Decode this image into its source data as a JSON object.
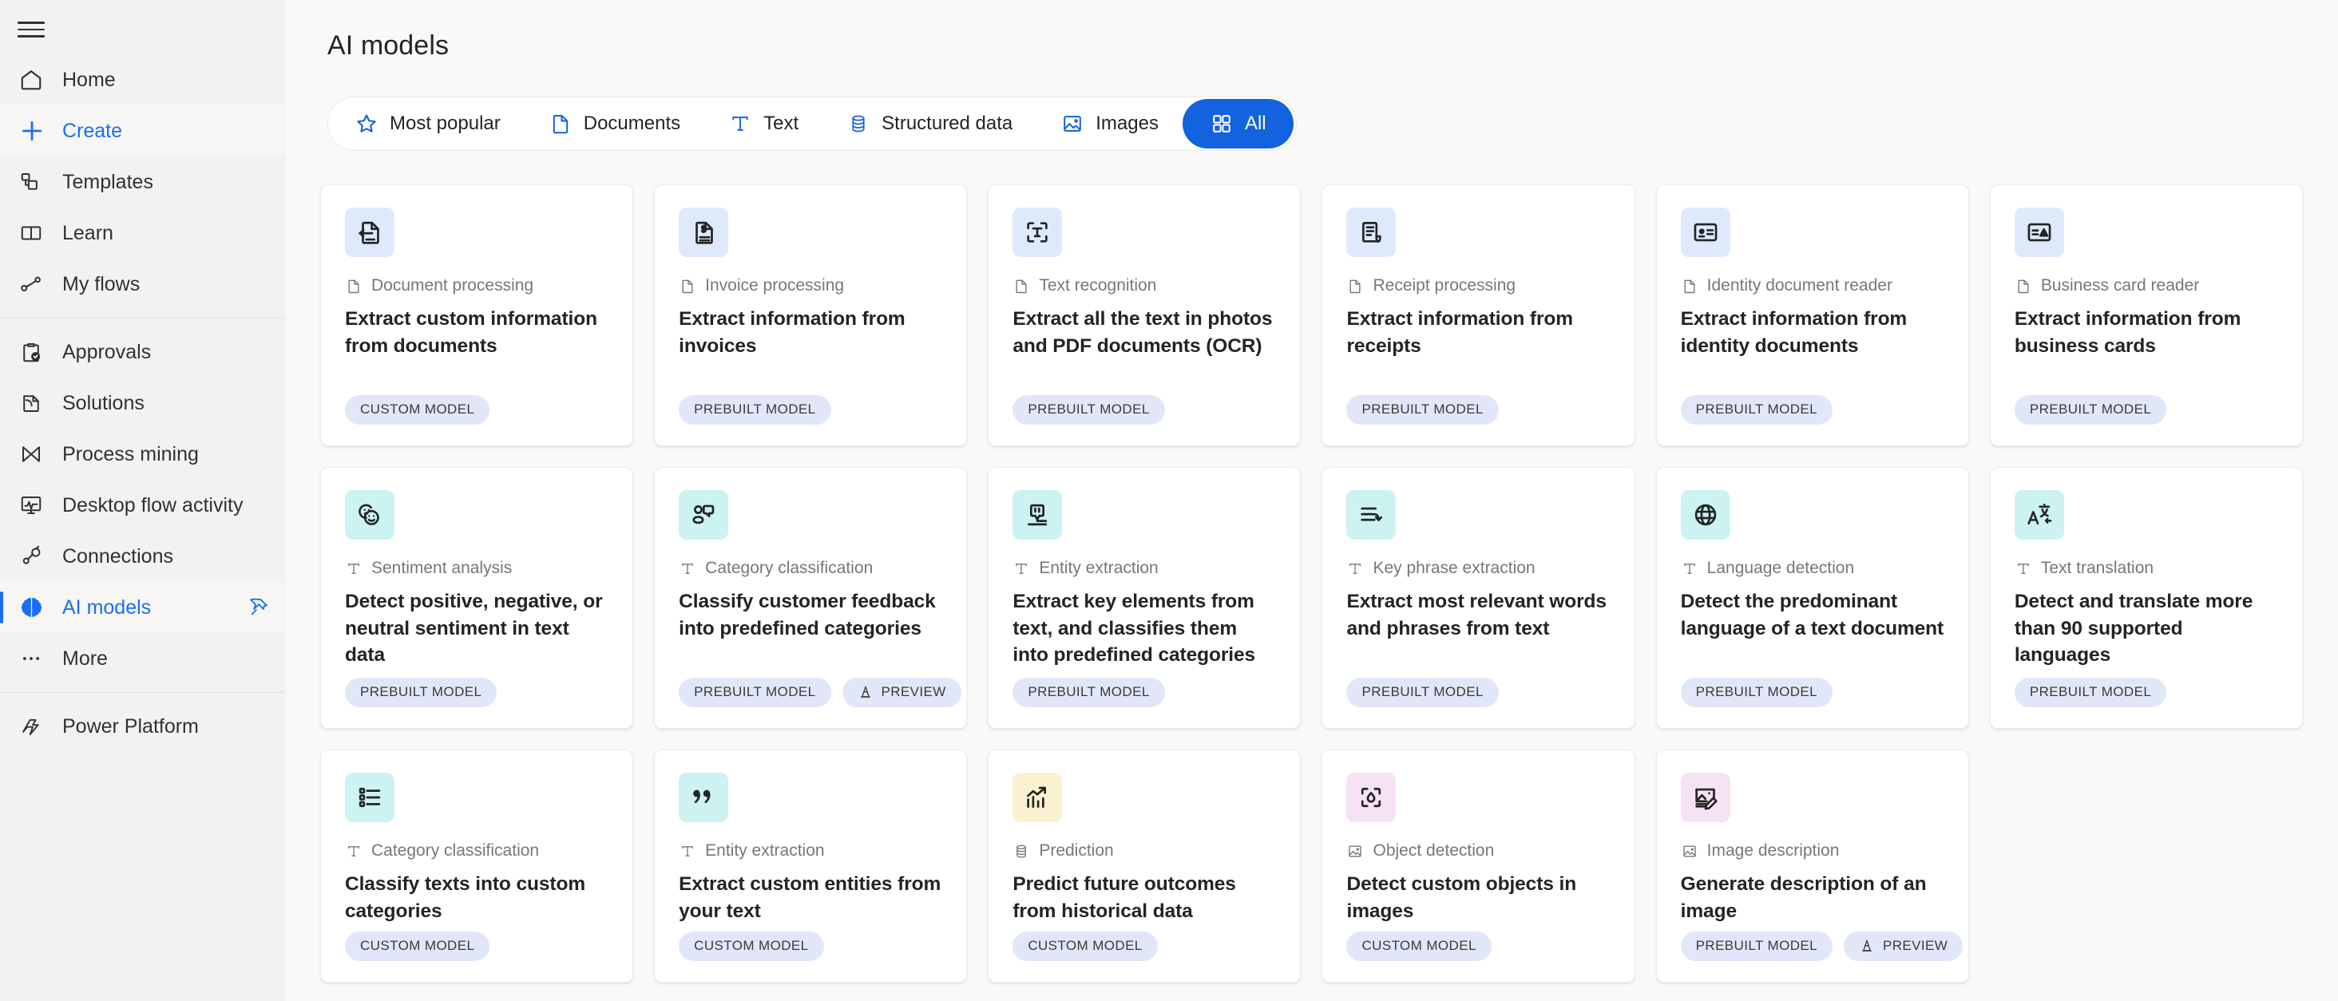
{
  "sidebar": {
    "menu_icon": "hamburger-icon",
    "groups": [
      {
        "items": [
          {
            "id": "home",
            "label": "Home",
            "icon": "home-icon",
            "active": false,
            "pinned": false
          },
          {
            "id": "create",
            "label": "Create",
            "icon": "plus-icon",
            "active": true,
            "pinned": false
          },
          {
            "id": "templates",
            "label": "Templates",
            "icon": "templates-icon",
            "active": false,
            "pinned": false
          },
          {
            "id": "learn",
            "label": "Learn",
            "icon": "book-icon",
            "active": false,
            "pinned": false
          },
          {
            "id": "myflows",
            "label": "My flows",
            "icon": "flow-icon",
            "active": false,
            "pinned": false
          }
        ]
      },
      {
        "items": [
          {
            "id": "approvals",
            "label": "Approvals",
            "icon": "clipboard-check-icon",
            "active": false,
            "pinned": false
          },
          {
            "id": "solutions",
            "label": "Solutions",
            "icon": "solutions-icon",
            "active": false,
            "pinned": false
          },
          {
            "id": "process",
            "label": "Process mining",
            "icon": "process-mining-icon",
            "active": false,
            "pinned": false
          },
          {
            "id": "desktop",
            "label": "Desktop flow activity",
            "icon": "monitor-pulse-icon",
            "active": false,
            "pinned": false
          },
          {
            "id": "connections",
            "label": "Connections",
            "icon": "plug-icon",
            "active": false,
            "pinned": false
          },
          {
            "id": "aimodels",
            "label": "AI models",
            "icon": "brain-icon",
            "active": true,
            "pinned": true
          },
          {
            "id": "more",
            "label": "More",
            "icon": "ellipsis-icon",
            "active": false,
            "pinned": false
          }
        ]
      },
      {
        "items": [
          {
            "id": "powerplatform",
            "label": "Power Platform",
            "icon": "power-platform-icon",
            "active": false,
            "pinned": false
          }
        ]
      }
    ]
  },
  "header": {
    "title": "AI models"
  },
  "filters": {
    "items": [
      {
        "id": "most-popular",
        "label": "Most popular",
        "icon": "star-icon",
        "selected": false
      },
      {
        "id": "documents",
        "label": "Documents",
        "icon": "document-icon",
        "selected": false
      },
      {
        "id": "text",
        "label": "Text",
        "icon": "text-t-icon",
        "selected": false
      },
      {
        "id": "structured",
        "label": "Structured data",
        "icon": "database-icon",
        "selected": false
      },
      {
        "id": "images",
        "label": "Images",
        "icon": "image-icon",
        "selected": false
      },
      {
        "id": "all",
        "label": "All",
        "icon": "grid-icon",
        "selected": true
      }
    ]
  },
  "colors": {
    "accent": "#1362de",
    "tile_blue": "#deeafb",
    "tile_teal": "#ccf2f2",
    "tile_yellow": "#faf1d2",
    "tile_pink": "#f5e3f3",
    "badge_bg": "#e1e7f8",
    "sidebar_bg": "#f3f2f1",
    "page_bg": "#faf9f8"
  },
  "badge_labels": {
    "custom": "CUSTOM MODEL",
    "prebuilt": "PREBUILT MODEL",
    "preview": "PREVIEW"
  },
  "cards": [
    {
      "id": "document-processing",
      "category": "Document processing",
      "category_icon": "document-icon",
      "title": "Extract custom information from documents",
      "icon": "document-extract-icon",
      "tile": "blue",
      "badges": [
        {
          "label": "CUSTOM MODEL",
          "type": "model"
        }
      ]
    },
    {
      "id": "invoice-processing",
      "category": "Invoice processing",
      "category_icon": "document-icon",
      "title": "Extract information from invoices",
      "icon": "invoice-icon",
      "tile": "blue",
      "badges": [
        {
          "label": "PREBUILT MODEL",
          "type": "model"
        }
      ]
    },
    {
      "id": "text-recognition",
      "category": "Text recognition",
      "category_icon": "document-icon",
      "title": "Extract all the text in photos and PDF documents (OCR)",
      "icon": "ocr-icon",
      "tile": "blue",
      "badges": [
        {
          "label": "PREBUILT MODEL",
          "type": "model"
        }
      ]
    },
    {
      "id": "receipt-processing",
      "category": "Receipt processing",
      "category_icon": "document-icon",
      "title": "Extract information from receipts",
      "icon": "receipt-icon",
      "tile": "blue",
      "badges": [
        {
          "label": "PREBUILT MODEL",
          "type": "model"
        }
      ]
    },
    {
      "id": "identity-document-reader",
      "category": "Identity document reader",
      "category_icon": "document-icon",
      "title": "Extract information from identity documents",
      "icon": "id-card-icon",
      "tile": "blue",
      "badges": [
        {
          "label": "PREBUILT MODEL",
          "type": "model"
        }
      ]
    },
    {
      "id": "business-card-reader",
      "category": "Business card reader",
      "category_icon": "document-icon",
      "title": "Extract information from business cards",
      "icon": "business-card-icon",
      "tile": "blue",
      "badges": [
        {
          "label": "PREBUILT MODEL",
          "type": "model"
        }
      ]
    },
    {
      "id": "sentiment-analysis",
      "category": "Sentiment analysis",
      "category_icon": "text-t-icon",
      "title": "Detect positive, negative, or neutral sentiment in text data",
      "icon": "emoji-faces-icon",
      "tile": "teal",
      "badges": [
        {
          "label": "PREBUILT MODEL",
          "type": "model"
        }
      ]
    },
    {
      "id": "category-classification-prebuilt",
      "category": "Category classification",
      "category_icon": "text-t-icon",
      "title": "Classify customer feedback into predefined categories",
      "icon": "feedback-bubble-icon",
      "tile": "teal",
      "badges": [
        {
          "label": "PREBUILT MODEL",
          "type": "model"
        },
        {
          "label": "PREVIEW",
          "type": "preview"
        }
      ]
    },
    {
      "id": "entity-extraction-prebuilt",
      "category": "Entity extraction",
      "category_icon": "text-t-icon",
      "title": "Extract key elements from text, and classifies them into predefined categories",
      "icon": "quote-extract-icon",
      "tile": "teal",
      "badges": [
        {
          "label": "PREBUILT MODEL",
          "type": "model"
        }
      ]
    },
    {
      "id": "key-phrase-extraction",
      "category": "Key phrase extraction",
      "category_icon": "text-t-icon",
      "title": "Extract most relevant words and phrases from text",
      "icon": "lines-arrow-icon",
      "tile": "teal",
      "badges": [
        {
          "label": "PREBUILT MODEL",
          "type": "model"
        }
      ]
    },
    {
      "id": "language-detection",
      "category": "Language detection",
      "category_icon": "text-t-icon",
      "title": "Detect the predominant language of a text document",
      "icon": "globe-icon",
      "tile": "teal",
      "badges": [
        {
          "label": "PREBUILT MODEL",
          "type": "model"
        }
      ]
    },
    {
      "id": "text-translation",
      "category": "Text translation",
      "category_icon": "text-t-icon",
      "title": "Detect and translate more than 90 supported languages",
      "icon": "translate-icon",
      "tile": "teal",
      "badges": [
        {
          "label": "PREBUILT MODEL",
          "type": "model"
        }
      ]
    },
    {
      "id": "category-classification-custom",
      "category": "Category classification",
      "category_icon": "text-t-icon",
      "title": "Classify texts into custom categories",
      "icon": "checklist-icon",
      "tile": "teal",
      "badges": [
        {
          "label": "CUSTOM MODEL",
          "type": "model"
        }
      ]
    },
    {
      "id": "entity-extraction-custom",
      "category": "Entity extraction",
      "category_icon": "text-t-icon",
      "title": "Extract custom entities from your text",
      "icon": "quotes-icon",
      "tile": "teal",
      "badges": [
        {
          "label": "CUSTOM MODEL",
          "type": "model"
        }
      ]
    },
    {
      "id": "prediction",
      "category": "Prediction",
      "category_icon": "database-icon",
      "title": "Predict future outcomes from historical data",
      "icon": "trend-chart-icon",
      "tile": "yellow",
      "badges": [
        {
          "label": "CUSTOM MODEL",
          "type": "model"
        }
      ]
    },
    {
      "id": "object-detection",
      "category": "Object detection",
      "category_icon": "image-icon",
      "title": "Detect custom objects in images",
      "icon": "object-scan-icon",
      "tile": "pink",
      "badges": [
        {
          "label": "CUSTOM MODEL",
          "type": "model"
        }
      ]
    },
    {
      "id": "image-description",
      "category": "Image description",
      "category_icon": "image-icon",
      "title": "Generate description of an image",
      "icon": "image-edit-icon",
      "tile": "pink",
      "badges": [
        {
          "label": "PREBUILT MODEL",
          "type": "model"
        },
        {
          "label": "PREVIEW",
          "type": "preview"
        }
      ]
    }
  ]
}
